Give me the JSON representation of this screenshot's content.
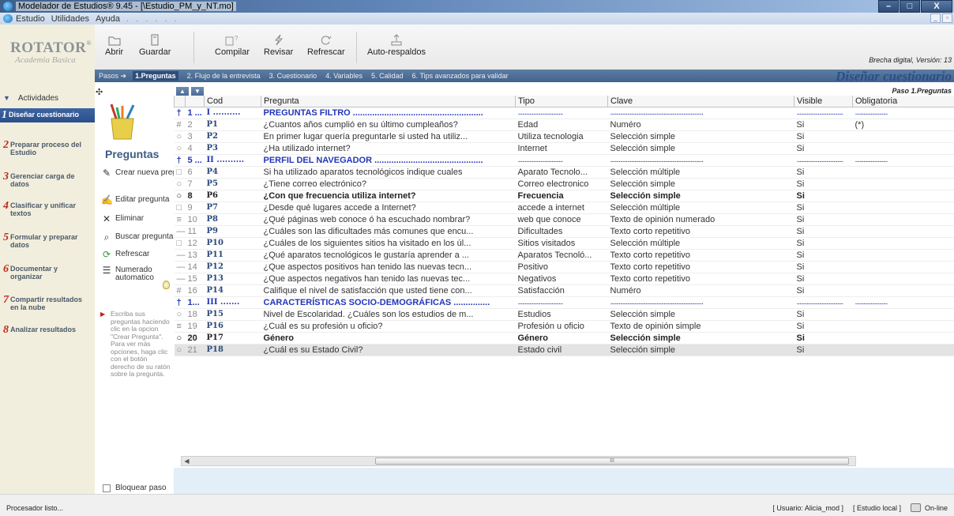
{
  "window": {
    "title": "Modelador de Estudios® 9.45 - [\\Estudio_PM_y_NT.mo]",
    "minimize": "–",
    "maximize": "□",
    "close": "X"
  },
  "menu": {
    "items": [
      "Estudio",
      "Utilidades",
      "Ayuda"
    ],
    "dots": ". . . . . ."
  },
  "brand": {
    "name": "ROTATOR",
    "reg": "®",
    "subtitle": "Academia Basica"
  },
  "toolbar": {
    "abrir": "Abrir",
    "guardar": "Guardar",
    "compilar": "Compilar",
    "revisar": "Revisar",
    "refrescar": "Refrescar",
    "autorespaldos": "Auto-respaldos"
  },
  "version_text": "Brecha digital, Versión: 13",
  "steps": {
    "label": "Pasos ➔",
    "items": [
      "1.Preguntas",
      "2. Flujo de la entrevista",
      "3. Cuestionario",
      "4. Variables",
      "5. Calidad",
      "6. Tips avanzados para validar"
    ],
    "active_index": 0
  },
  "page_title": "Diseñar cuestionario",
  "paso_label": "Paso 1.Preguntas",
  "actividades_label": "Actividades",
  "nav": [
    {
      "num": "1",
      "label": "Diseñar cuestionario"
    },
    {
      "num": "2",
      "label": "Preparar proceso del Estudio"
    },
    {
      "num": "3",
      "label": "Gerenciar carga de datos"
    },
    {
      "num": "4",
      "label": "Clasificar y unificar textos"
    },
    {
      "num": "5",
      "label": "Formular y preparar datos"
    },
    {
      "num": "6",
      "label": "Documentar y organizar"
    },
    {
      "num": "7",
      "label": "Compartir resultados en la nube"
    },
    {
      "num": "8",
      "label": "Analizar resultados"
    }
  ],
  "panel": {
    "title": "Preguntas",
    "actions": [
      {
        "icon": "pencil-icon",
        "label": "Crear nueva pregunta"
      },
      {
        "icon": "edit-icon",
        "label": "Editar pregunta"
      },
      {
        "icon": "delete-icon",
        "label": "Eliminar"
      },
      {
        "icon": "search-icon",
        "label": "Buscar pregunta"
      },
      {
        "icon": "refresh-icon",
        "label": "Refrescar"
      },
      {
        "icon": "numbered-list-icon",
        "label": "Numerado automatico"
      }
    ],
    "hint": "Escriba sus preguntas haciendo clic en la opcion \"Crear Pregunta\". Para ver más opciones, haga clic con el botón derecho de su ratón sobre la pregunta.",
    "bloquear": "Bloquear paso"
  },
  "grid": {
    "columns": [
      "Cod",
      "Pregunta",
      "Tipo",
      "Clave",
      "Visible",
      "Obligatoria"
    ],
    "rows": [
      {
        "icon": "†",
        "num": "1 ...",
        "cod": "I ..........",
        "pregunta": "PREGUNTAS FILTRO ......................................................",
        "tipo": "................................",
        "clave": "..................................................................",
        "visible": ".................................",
        "obl": ".......................",
        "kind": "sec"
      },
      {
        "icon": "#",
        "num": "2",
        "cod": "P1",
        "pregunta": "¿Cuantos años cumplió en su último cumpleaños?",
        "tipo": "Edad",
        "clave": "Numéro",
        "visible": "Si",
        "obl": "(*)",
        "kind": "row"
      },
      {
        "icon": "○",
        "num": "3",
        "cod": "P2",
        "pregunta": "En primer lugar quería preguntarle si usted ha utiliz...",
        "tipo": "Utiliza tecnologia",
        "clave": "Selección simple",
        "visible": "Si",
        "obl": "",
        "kind": "row"
      },
      {
        "icon": "○",
        "num": "4",
        "cod": "P3",
        "pregunta": "¿Ha utilizado internet?",
        "tipo": "Internet",
        "clave": "Selección simple",
        "visible": "Si",
        "obl": "",
        "kind": "row"
      },
      {
        "icon": "†",
        "num": "5 ...",
        "cod": "II ..........",
        "pregunta": "PERFIL DEL NAVEGADOR .............................................",
        "tipo": "................................",
        "clave": "..................................................................",
        "visible": ".................................",
        "obl": ".......................",
        "kind": "sec"
      },
      {
        "icon": "□",
        "num": "6",
        "cod": "P4",
        "pregunta": "Si ha utilizado aparatos tecnológicos indique cuales",
        "tipo": "Aparato Tecnolo...",
        "clave": "Selección múltiple",
        "visible": "Si",
        "obl": "",
        "kind": "row"
      },
      {
        "icon": "○",
        "num": "7",
        "cod": "P5",
        "pregunta": "¿Tiene correo electrónico?",
        "tipo": "Correo electronico",
        "clave": "Selección simple",
        "visible": "Si",
        "obl": "",
        "kind": "row"
      },
      {
        "icon": "○",
        "num": "8",
        "cod": "P6",
        "pregunta": "¿Con que frecuencia utiliza internet?",
        "tipo": "Frecuencia",
        "clave": "Selección simple",
        "visible": "Si",
        "obl": "",
        "kind": "bold"
      },
      {
        "icon": "□",
        "num": "9",
        "cod": "P7",
        "pregunta": "¿Desde qué lugares accede a Internet?",
        "tipo": "accede a internet",
        "clave": "Selección múltiple",
        "visible": "Si",
        "obl": "",
        "kind": "row"
      },
      {
        "icon": "≡",
        "num": "10",
        "cod": "P8",
        "pregunta": "¿Qué páginas web conoce ó ha escuchado nombrar?",
        "tipo": "web que conoce",
        "clave": "Texto de opinión numerado",
        "visible": "Si",
        "obl": "",
        "kind": "row"
      },
      {
        "icon": "—",
        "num": "11",
        "cod": "P9",
        "pregunta": "¿Cuáles son las dificultades más comunes que encu...",
        "tipo": "Dificultades",
        "clave": "Texto corto repetitivo",
        "visible": "Si",
        "obl": "",
        "kind": "row"
      },
      {
        "icon": "□",
        "num": "12",
        "cod": "P10",
        "pregunta": "¿Cuáles de los siguientes sitios ha visitado en los úl...",
        "tipo": "Sitios visitados",
        "clave": "Selección múltiple",
        "visible": "Si",
        "obl": "",
        "kind": "row"
      },
      {
        "icon": "—",
        "num": "13",
        "cod": "P11",
        "pregunta": "¿Qué aparatos tecnológicos le gustaría aprender a ...",
        "tipo": "Aparatos Tecnoló...",
        "clave": "Texto corto repetitivo",
        "visible": "Si",
        "obl": "",
        "kind": "row"
      },
      {
        "icon": "—",
        "num": "14",
        "cod": "P12",
        "pregunta": "¿Que aspectos positivos han tenido las nuevas tecn...",
        "tipo": "Positivo",
        "clave": "Texto corto repetitivo",
        "visible": "Si",
        "obl": "",
        "kind": "row"
      },
      {
        "icon": "—",
        "num": "15",
        "cod": "P13",
        "pregunta": "¿Que aspectos negativos han tenido las nuevas tec...",
        "tipo": "Negativos",
        "clave": "Texto corto repetitivo",
        "visible": "Si",
        "obl": "",
        "kind": "row"
      },
      {
        "icon": "#",
        "num": "16",
        "cod": "P14",
        "pregunta": "Califique el nivel de satisfacción que usted tiene con...",
        "tipo": "Satisfacción",
        "clave": "Numéro",
        "visible": "Si",
        "obl": "",
        "kind": "row"
      },
      {
        "icon": "†",
        "num": "1...",
        "cod": "III .......",
        "pregunta": "CARACTERÍSTICAS SOCIO-DEMOGRÁFICAS ...............",
        "tipo": "................................",
        "clave": "..................................................................",
        "visible": ".................................",
        "obl": ".......................",
        "kind": "sec"
      },
      {
        "icon": "○",
        "num": "18",
        "cod": "P15",
        "pregunta": "Nivel de Escolaridad. ¿Cuáles son los estudios de m...",
        "tipo": "Estudios",
        "clave": "Selección simple",
        "visible": "Si",
        "obl": "",
        "kind": "row"
      },
      {
        "icon": "≡",
        "num": "19",
        "cod": "P16",
        "pregunta": "¿Cuál es su profesión u oficio?",
        "tipo": "Profesión u oficio",
        "clave": "Texto de opinión simple",
        "visible": "Si",
        "obl": "",
        "kind": "row"
      },
      {
        "icon": "○",
        "num": "20",
        "cod": "P17",
        "pregunta": "Género",
        "tipo": "Género",
        "clave": "Selección simple",
        "visible": "Si",
        "obl": "",
        "kind": "bold"
      },
      {
        "icon": "○",
        "num": "21",
        "cod": "P18",
        "pregunta": "¿Cuál es su Estado Civil?",
        "tipo": "Estado civil",
        "clave": "Selección simple",
        "visible": "Si",
        "obl": "",
        "kind": "sel"
      }
    ]
  },
  "scroll_grip": "III",
  "status": {
    "left": "Procesador listo...",
    "user": "[ Usuario: Alicia_mod ]",
    "study": "[ Estudio local ]",
    "online": "On-line"
  }
}
